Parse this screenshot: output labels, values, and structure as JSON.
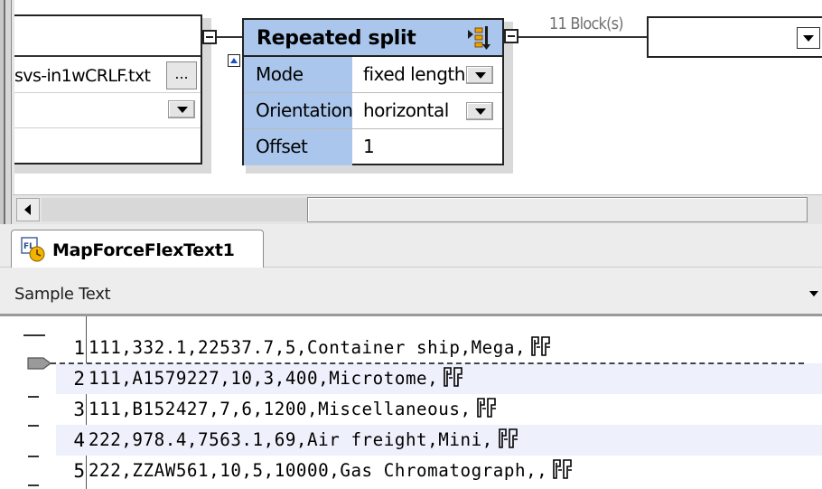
{
  "mapping": {
    "left_component": {
      "file_name": "svs-in1wCRLF.txt",
      "browse_label": "..."
    },
    "split_component": {
      "title": "Repeated split",
      "properties": [
        {
          "label": "Mode",
          "value": "fixed length"
        },
        {
          "label": "Orientation",
          "value": "horizontal"
        },
        {
          "label": "Offset",
          "value": "1"
        }
      ]
    },
    "connection_label": "11 Block(s)"
  },
  "tab": {
    "label": "MapForceFlexText1"
  },
  "sample_panel": {
    "title": "Sample Text"
  },
  "sample_lines": [
    {
      "no": "1",
      "text": "111,332.1,22537.7,5,Container ship,Mega,"
    },
    {
      "no": "2",
      "text": "111,A1579227,10,3,400,Microtome,"
    },
    {
      "no": "3",
      "text": "111,B152427,7,6,1200,Miscellaneous,"
    },
    {
      "no": "4",
      "text": "222,978.4,7563.1,69,Air freight,Mini,"
    },
    {
      "no": "5",
      "text": "222,ZZAW561,10,5,10000,Gas Chromatograph,,"
    }
  ],
  "colors": {
    "header_blue": "#aac6ec",
    "alt_row": "#eef0fb",
    "split_icon_orange": "#f0a000"
  },
  "icons": {
    "split_component": "repeated-split-icon",
    "tab": "flextext-tab-icon",
    "line_end": "crlf-icon"
  }
}
